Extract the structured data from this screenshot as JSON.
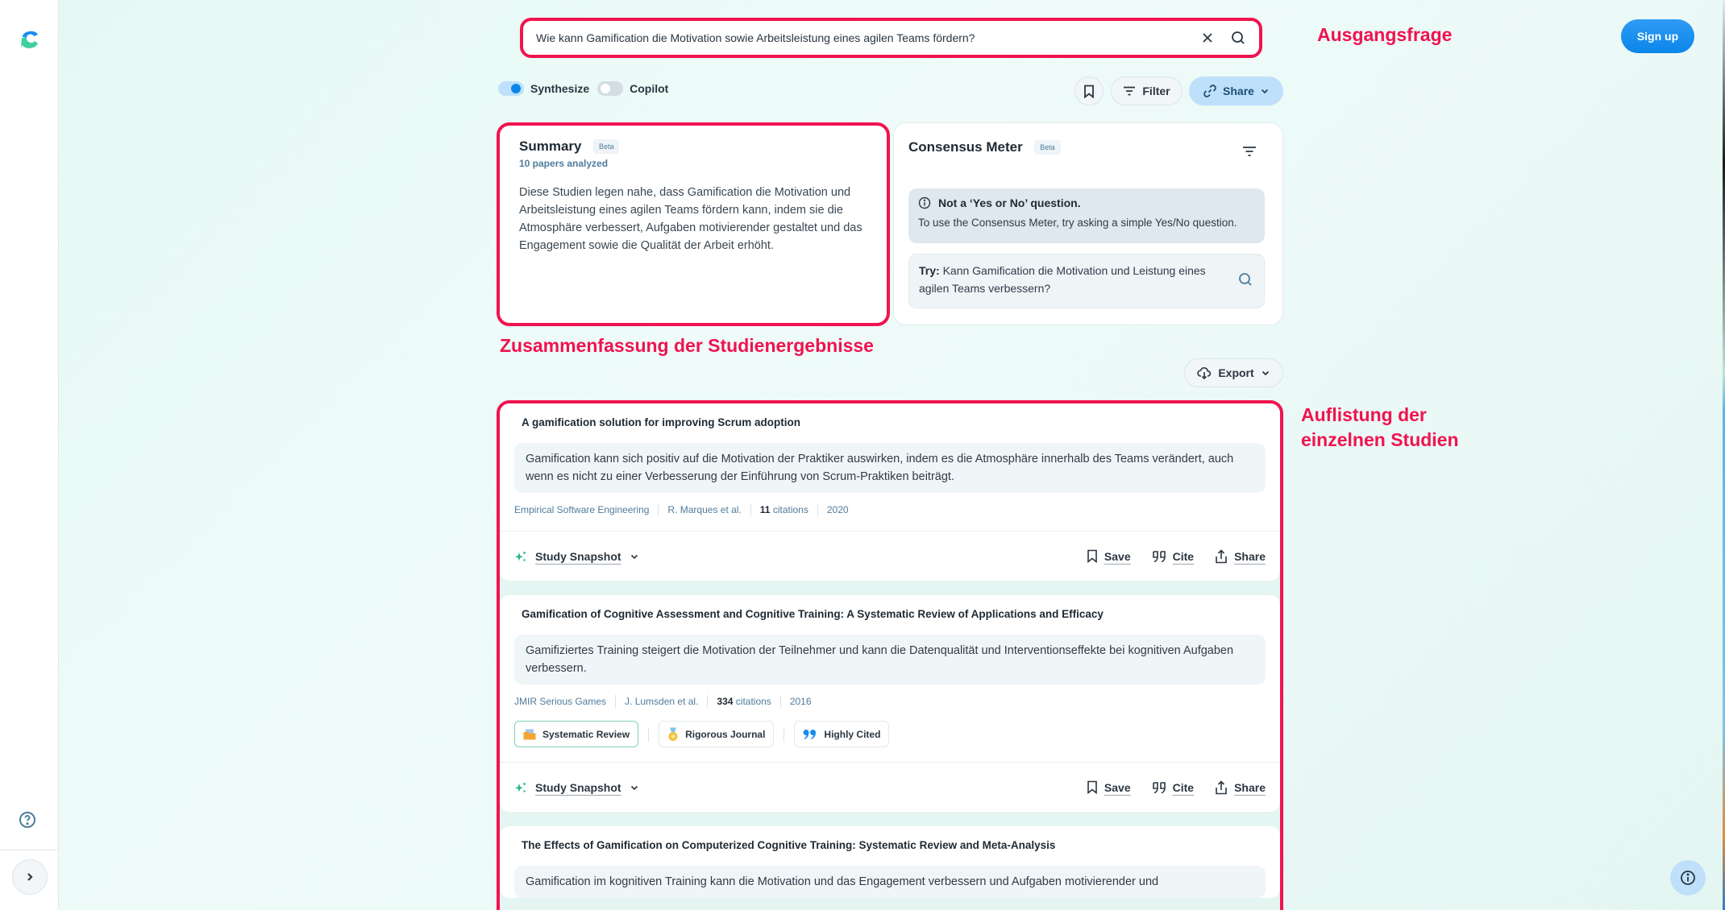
{
  "app": {
    "name": "Consensus"
  },
  "search": {
    "value": "Wie kann Gamification die Motivation sowie Arbeitsleistung eines agilen Teams fördern?",
    "clear_icon": "close-icon",
    "search_icon": "search-icon"
  },
  "header": {
    "signup_label": "Sign up"
  },
  "annotations": {
    "question": "Ausgangsfrage",
    "summary": "Zusammenfassung der Studienergebnisse",
    "list": "Auflistung der einzelnen Studien"
  },
  "toolbar": {
    "toggles": [
      {
        "label": "Synthesize",
        "on": true
      },
      {
        "label": "Copilot",
        "on": false
      }
    ],
    "filter_label": "Filter",
    "share_label": "Share",
    "export_label": "Export"
  },
  "summary": {
    "title": "Summary",
    "badge": "Beta",
    "papers_analyzed": "10 papers analyzed",
    "text": "Diese Studien legen nahe, dass Gamification die Motivation und Arbeitsleistung eines agilen Teams fördern kann, indem sie die Atmosphäre verbessert, Aufgaben motivierender gestaltet und das Engagement sowie die Qualität der Arbeit erhöht."
  },
  "consensus": {
    "title": "Consensus Meter",
    "badge": "Beta",
    "notice_title": "Not a ‘Yes or No’ question.",
    "notice_body": "To use the Consensus Meter, try asking a simple Yes/No question.",
    "try_prefix": "Try:",
    "try_text": " Kann Gamification die Motivation und Leistung eines agilen Teams verbessern?"
  },
  "papers": [
    {
      "title": "A gamification solution for improving Scrum adoption",
      "claim": "Gamification kann sich positiv auf die Motivation der Praktiker auswirken, indem es die Atmosphäre innerhalb des Teams verändert, auch wenn es nicht zu einer Verbesserung der Einführung von Scrum-Praktiken beiträgt.",
      "journal": "Empirical Software Engineering",
      "authors": "R. Marques et al.",
      "citations_count": "11",
      "citations_label": " citations",
      "year": "2020",
      "badges": []
    },
    {
      "title": "Gamification of Cognitive Assessment and Cognitive Training: A Systematic Review of Applications and Efficacy",
      "claim": "Gamifiziertes Training steigert die Motivation der Teilnehmer und kann die Datenqualität und Interventionseffekte bei kognitiven Aufgaben verbessern.",
      "journal": "JMIR Serious Games",
      "authors": "J. Lumsden et al.",
      "citations_count": "334",
      "citations_label": " citations",
      "year": "2016",
      "badges": [
        "Systematic Review",
        "Rigorous Journal",
        "Highly Cited"
      ]
    },
    {
      "title": "The Effects of Gamification on Computerized Cognitive Training: Systematic Review and Meta-Analysis",
      "claim": "Gamification im kognitiven Training kann die Motivation und das Engagement verbessern und Aufgaben motivierender und"
    }
  ],
  "paper_actions": {
    "snapshot": "Study Snapshot",
    "save": "Save",
    "cite": "Cite",
    "share": "Share"
  }
}
